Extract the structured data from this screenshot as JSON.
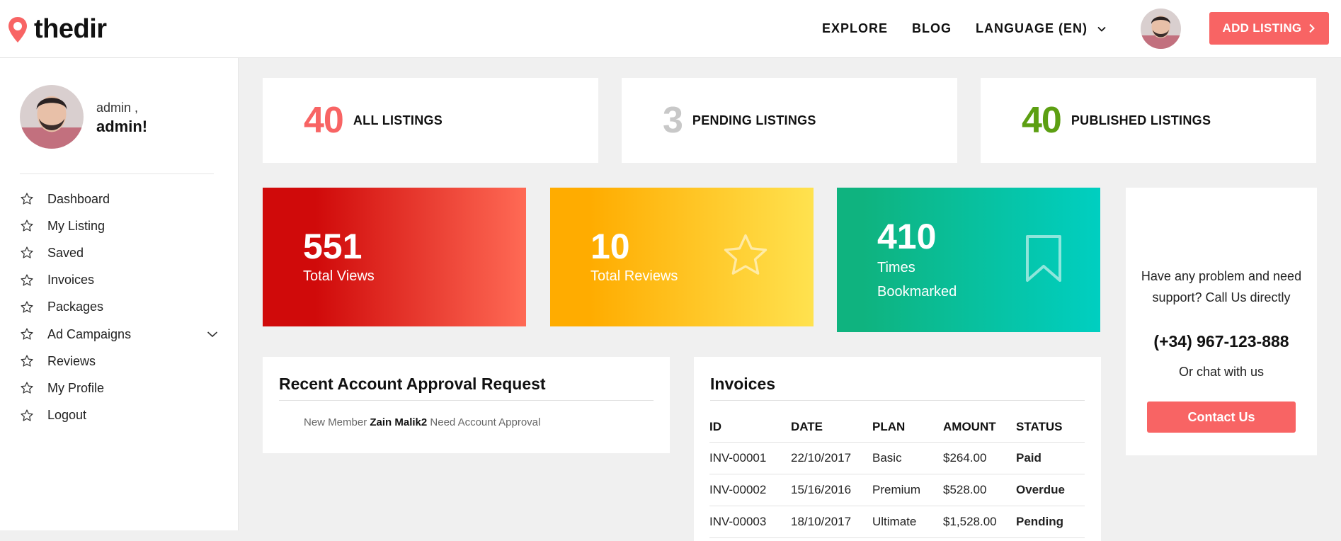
{
  "header": {
    "logo_text": "thedir",
    "nav": [
      {
        "label": "EXPLORE"
      },
      {
        "label": "BLOG"
      },
      {
        "label": "LANGUAGE (EN)"
      }
    ],
    "add_listing_label": "ADD LISTING"
  },
  "sidebar": {
    "greeting": "admin ,",
    "name": "admin!",
    "items": [
      {
        "label": "Dashboard"
      },
      {
        "label": "My Listing"
      },
      {
        "label": "Saved"
      },
      {
        "label": "Invoices"
      },
      {
        "label": "Packages"
      },
      {
        "label": "Ad Campaigns"
      },
      {
        "label": "Reviews"
      },
      {
        "label": "My Profile"
      },
      {
        "label": "Logout"
      }
    ]
  },
  "stats": [
    {
      "value": "40",
      "label": "ALL LISTINGS",
      "color": "#f86464"
    },
    {
      "value": "3",
      "label": "PENDING LISTINGS",
      "color": "#c8c8c8"
    },
    {
      "value": "40",
      "label": "PUBLISHED LISTINGS",
      "color": "#5c9f12"
    }
  ],
  "tiles": [
    {
      "value": "551",
      "label": "Total Views",
      "color_from": "#d00a0a",
      "color_to": "#ff6a55"
    },
    {
      "value": "10",
      "label": "Total Reviews",
      "color_from": "#ffac00",
      "color_to": "#ffe24f",
      "icon": "star-icon"
    },
    {
      "value": "410",
      "label_line1": "Times",
      "label_line2": "Bookmarked",
      "color_from": "#0fb37f",
      "color_to": "#00cfc1",
      "icon": "bookmark-icon"
    }
  ],
  "support": {
    "text": "Have any problem and need support? Call Us directly",
    "phone": "(+34) 967-123-888",
    "chat": "Or chat with us",
    "button": "Contact Us"
  },
  "approval": {
    "title": "Recent Account Approval Request",
    "prefix": "New Member",
    "member": "Zain Malik2",
    "suffix": "Need Account Approval"
  },
  "invoices": {
    "title": "Invoices",
    "columns": [
      "ID",
      "DATE",
      "PLAN",
      "AMOUNT",
      "STATUS"
    ],
    "rows": [
      {
        "id": "INV-00001",
        "date": "22/10/2017",
        "plan": "Basic",
        "amount": "$264.00",
        "status": "Paid"
      },
      {
        "id": "INV-00002",
        "date": "15/16/2016",
        "plan": "Premium",
        "amount": "$528.00",
        "status": "Overdue"
      },
      {
        "id": "INV-00003",
        "date": "18/10/2017",
        "plan": "Ultimate",
        "amount": "$1,528.00",
        "status": "Pending"
      }
    ]
  }
}
